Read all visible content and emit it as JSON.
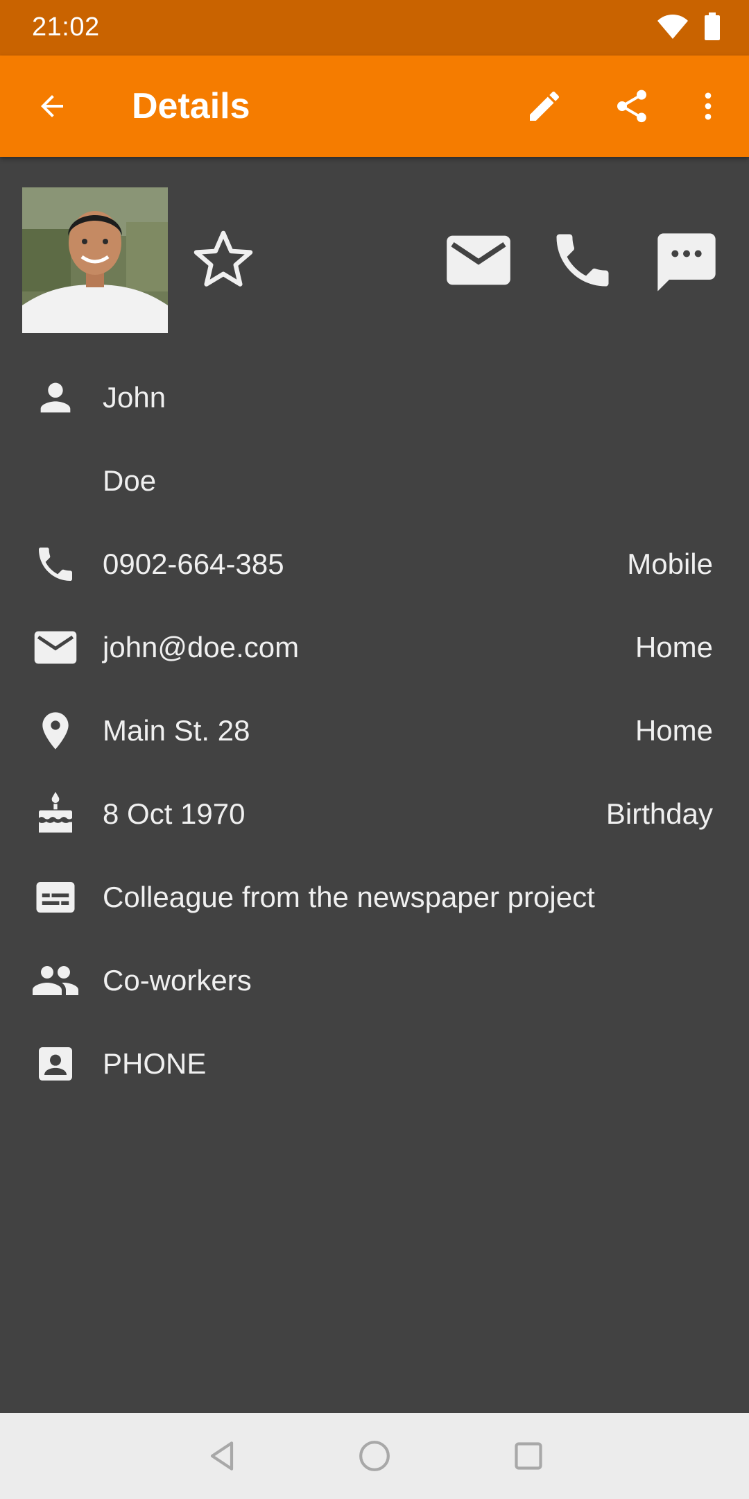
{
  "status_bar": {
    "time": "21:02",
    "icons": [
      "wifi-icon",
      "battery-icon"
    ]
  },
  "app_bar": {
    "title": "Details",
    "actions": [
      "back-icon",
      "edit-icon",
      "share-icon",
      "more-vert-icon"
    ],
    "color": "#f57c00"
  },
  "header": {
    "photo": "contact-photo",
    "favorite": "star-outline-icon",
    "quick_actions": [
      "email-icon",
      "phone-icon",
      "sms-icon"
    ]
  },
  "details": {
    "first_name": "John",
    "surname": "Doe",
    "phone": {
      "value": "0902-664-385",
      "type": "Mobile"
    },
    "email": {
      "value": "john@doe.com",
      "type": "Home"
    },
    "address": {
      "value": "Main St. 28",
      "type": "Home"
    },
    "event": {
      "value": "8 Oct 1970",
      "type": "Birthday"
    },
    "note": "Colleague from the newspaper project",
    "group": "Co-workers",
    "source": "PHONE"
  },
  "colors": {
    "status_bar": "#c96300",
    "background": "#424242",
    "text": "#f0f0f0",
    "nav_bar": "#ececec"
  }
}
